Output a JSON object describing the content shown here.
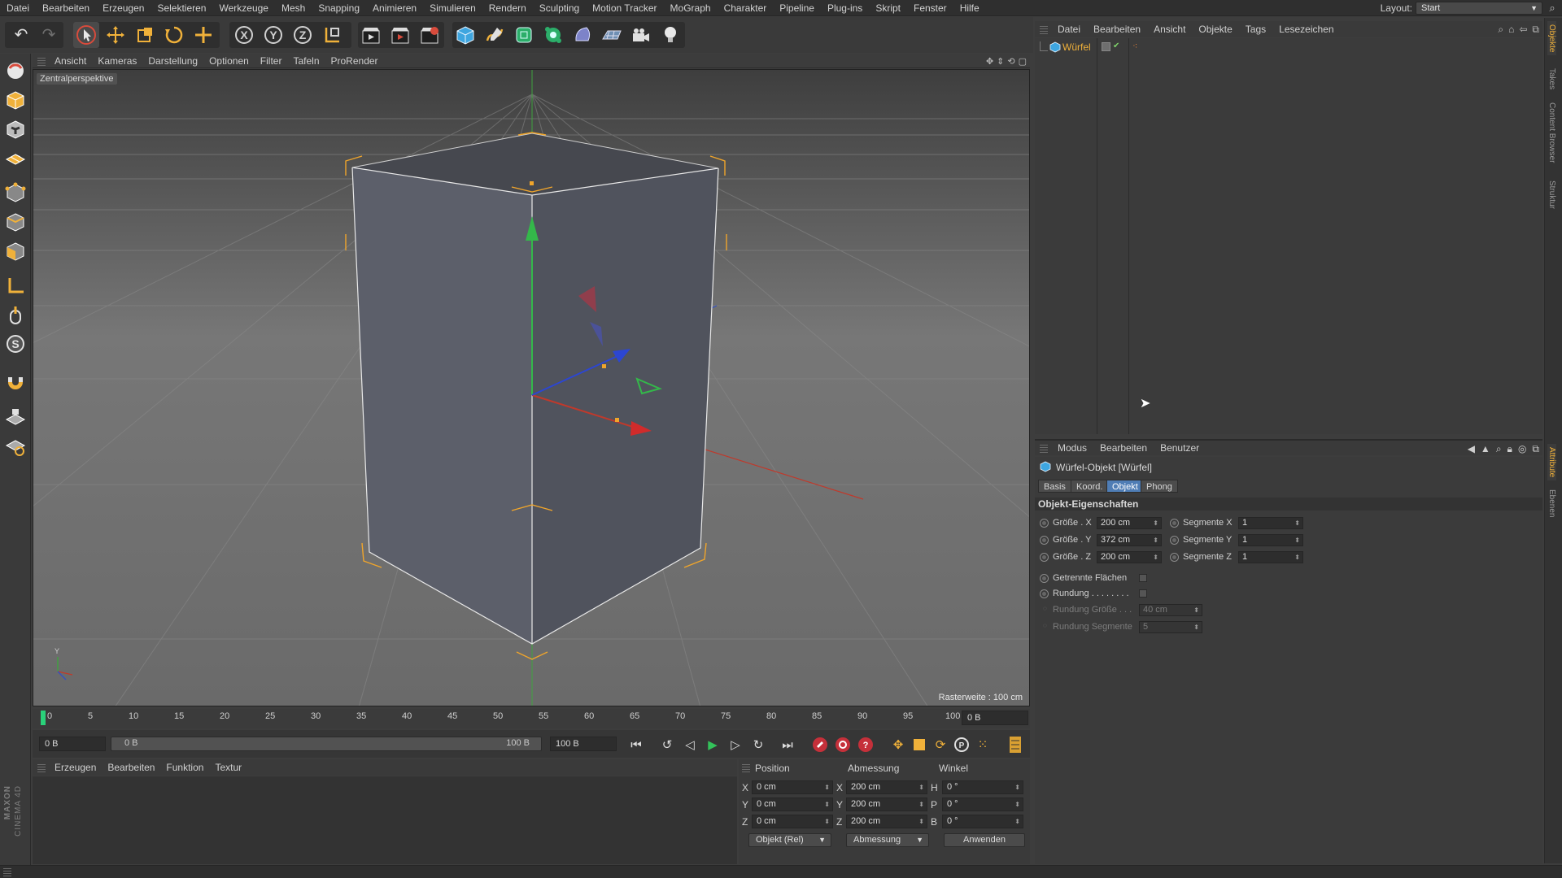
{
  "menubar": {
    "items": [
      "Datei",
      "Bearbeiten",
      "Erzeugen",
      "Selektieren",
      "Werkzeuge",
      "Mesh",
      "Snapping",
      "Animieren",
      "Simulieren",
      "Rendern",
      "Sculpting",
      "Motion Tracker",
      "MoGraph",
      "Charakter",
      "Pipeline",
      "Plug-ins",
      "Skript",
      "Fenster",
      "Hilfe"
    ],
    "layout_label": "Layout:",
    "layout_value": "Start"
  },
  "toolbar": {
    "icons": [
      "undo-icon",
      "redo-icon",
      "select-arrow-icon",
      "move-icon",
      "scale-icon",
      "rotate-icon",
      "add-object-icon",
      "x-axis-icon",
      "y-axis-icon",
      "z-axis-icon",
      "coordinate-system-icon",
      "render-view-icon",
      "render-picture-viewer-icon",
      "render-settings-icon",
      "cube-primitive-icon",
      "pen-spline-icon",
      "subdivision-icon",
      "cloner-icon",
      "deformer-icon",
      "floor-icon",
      "camera-icon",
      "light-icon"
    ]
  },
  "viewport": {
    "menu": [
      "Ansicht",
      "Kameras",
      "Darstellung",
      "Optionen",
      "Filter",
      "Tafeln",
      "ProRender"
    ],
    "label": "Zentralperspektive",
    "raster": "Rasterweite : 100 cm"
  },
  "timeline": {
    "ticks": [
      "0",
      "5",
      "10",
      "15",
      "20",
      "25",
      "30",
      "35",
      "40",
      "45",
      "50",
      "55",
      "60",
      "65",
      "70",
      "75",
      "80",
      "85",
      "90",
      "95",
      "100"
    ],
    "current_frame": "0 B"
  },
  "playback": {
    "start": "0 B",
    "range_start": "0 B",
    "range_end": "100 B",
    "end": "100 B"
  },
  "material": {
    "menu": [
      "Erzeugen",
      "Bearbeiten",
      "Funktion",
      "Textur"
    ]
  },
  "coords": {
    "headers": {
      "position": "Position",
      "size": "Abmessung",
      "angle": "Winkel"
    },
    "rows": [
      {
        "axis": "X",
        "pos": "0 cm",
        "size_axis": "X",
        "size": "200 cm",
        "angle_axis": "H",
        "angle": "0 °"
      },
      {
        "axis": "Y",
        "pos": "0 cm",
        "size_axis": "Y",
        "size": "200 cm",
        "angle_axis": "P",
        "angle": "0 °"
      },
      {
        "axis": "Z",
        "pos": "0 cm",
        "size_axis": "Z",
        "size": "200 cm",
        "angle_axis": "B",
        "angle": "0 °"
      }
    ],
    "mode_select": "Objekt (Rel)",
    "size_select": "Abmessung",
    "apply": "Anwenden"
  },
  "object_manager": {
    "menu": [
      "Datei",
      "Bearbeiten",
      "Ansicht",
      "Objekte",
      "Tags",
      "Lesezeichen"
    ],
    "objects": [
      {
        "name": "Würfel"
      }
    ]
  },
  "attribute_manager": {
    "menu": [
      "Modus",
      "Bearbeiten",
      "Benutzer"
    ],
    "title": "Würfel-Objekt [Würfel]",
    "tabs": [
      "Basis",
      "Koord.",
      "Objekt",
      "Phong"
    ],
    "active_tab": "Objekt",
    "section": "Objekt-Eigenschaften",
    "size_rows": [
      {
        "label": "Größe . X",
        "value": "200 cm",
        "seg_label": "Segmente X",
        "seg_value": "1"
      },
      {
        "label": "Größe . Y",
        "value": "372 cm",
        "seg_label": "Segmente Y",
        "seg_value": "1"
      },
      {
        "label": "Größe . Z",
        "value": "200 cm",
        "seg_label": "Segmente Z",
        "seg_value": "1"
      }
    ],
    "separate_faces": "Getrennte Flächen",
    "fillet": "Rundung . . . . . . . .",
    "fillet_size": "Rundung Größe . . .",
    "fillet_size_value": "40 cm",
    "fillet_segments": "Rundung Segmente",
    "fillet_segments_value": "5"
  },
  "right_tabs": [
    "Objekte",
    "Takes",
    "Content Browser",
    "Struktur",
    "Attribute",
    "Ebenen"
  ],
  "branding": {
    "maxon": "MAXON",
    "cinema": "CINEMA 4D"
  },
  "colors": {
    "accent_orange": "#f0b13a",
    "selection_blue": "#4f7db5",
    "timeline_marker": "#2ad27a"
  }
}
